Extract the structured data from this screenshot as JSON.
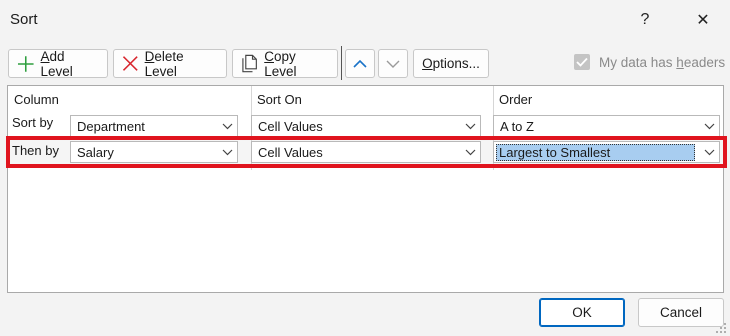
{
  "window": {
    "title": "Sort",
    "help_glyph": "?",
    "close_glyph": "✕"
  },
  "toolbar": {
    "add_level_pre": "",
    "add_level_mnemonic": "A",
    "add_level_post": "dd Level",
    "delete_level_pre": "",
    "delete_level_mnemonic": "D",
    "delete_level_post": "elete Level",
    "copy_level_pre": "",
    "copy_level_mnemonic": "C",
    "copy_level_post": "opy Level",
    "options_pre": "",
    "options_mnemonic": "O",
    "options_post": "ptions...",
    "headers_pre": "My data has ",
    "headers_mnemonic": "h",
    "headers_post": "eaders",
    "headers_checked": true
  },
  "grid": {
    "columns": [
      "Column",
      "Sort On",
      "Order"
    ],
    "rows": [
      {
        "label": "Sort by",
        "column": "Department",
        "sort_on": "Cell Values",
        "order": "A to Z"
      },
      {
        "label": "Then by",
        "column": "Salary",
        "sort_on": "Cell Values",
        "order": "Largest to Smallest"
      }
    ]
  },
  "footer": {
    "ok_label": "OK",
    "cancel_label": "Cancel"
  },
  "colors": {
    "highlight": "#e0141e",
    "accent": "#0067c0",
    "selection": "#a8cdf0"
  }
}
